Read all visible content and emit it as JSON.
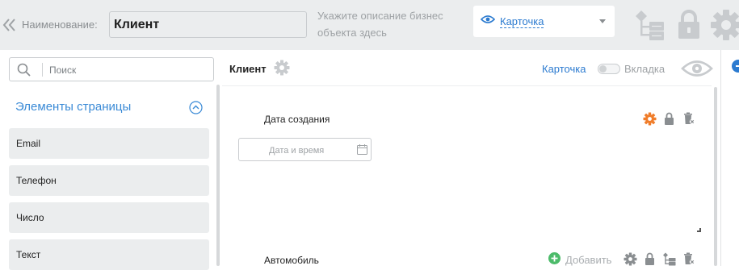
{
  "topbar": {
    "name_label": "Наименование:",
    "name_value": "Клиент",
    "description_placeholder": "Укажите описание бизнес объекта здесь",
    "view_select": {
      "value": "Карточка"
    },
    "icons": [
      "double-chevron-left-icon",
      "eye-icon",
      "caret-down-icon",
      "hierarchy-icon",
      "lock-icon",
      "gear-icon"
    ]
  },
  "sidebar": {
    "search_placeholder": "Поиск",
    "section_title": "Элементы страницы",
    "items": [
      {
        "label": "Email"
      },
      {
        "label": "Телефон"
      },
      {
        "label": "Число"
      },
      {
        "label": "Текст"
      }
    ]
  },
  "main": {
    "title": "Клиент",
    "mode_card": "Карточка",
    "mode_tab": "Вкладка",
    "mode_toggle_on": false,
    "fields": [
      {
        "label": "Дата создания",
        "placeholder": "Дата и время"
      },
      {
        "label": "Автомобиль",
        "add_label": "Добавить"
      }
    ]
  },
  "colors": {
    "accent_blue": "#2c7bd0",
    "orange_gear": "#f07d2a",
    "add_green": "#4cbb6a",
    "topbar_bg": "#ebedee",
    "icon_gray": "#c8cbce"
  }
}
